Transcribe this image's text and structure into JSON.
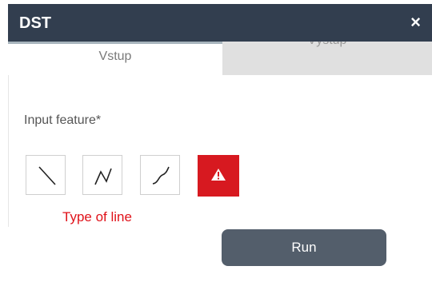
{
  "header": {
    "title": "DST",
    "close_label": "×"
  },
  "tabs": [
    {
      "label": "Vstup",
      "active": true
    },
    {
      "label": "Výstup",
      "active": false
    }
  ],
  "form": {
    "input_label": "Input feature*",
    "line_type_caption": "Type of line",
    "line_types": [
      {
        "icon": "straight-line-icon"
      },
      {
        "icon": "polyline-icon"
      },
      {
        "icon": "curve-line-icon"
      },
      {
        "icon": "warning-icon"
      }
    ]
  },
  "actions": {
    "run_label": "Run"
  },
  "colors": {
    "header_bg": "#323e4f",
    "warning_bg": "#d71920",
    "caption_red": "#e0121a",
    "run_button_bg": "#535e6b"
  }
}
